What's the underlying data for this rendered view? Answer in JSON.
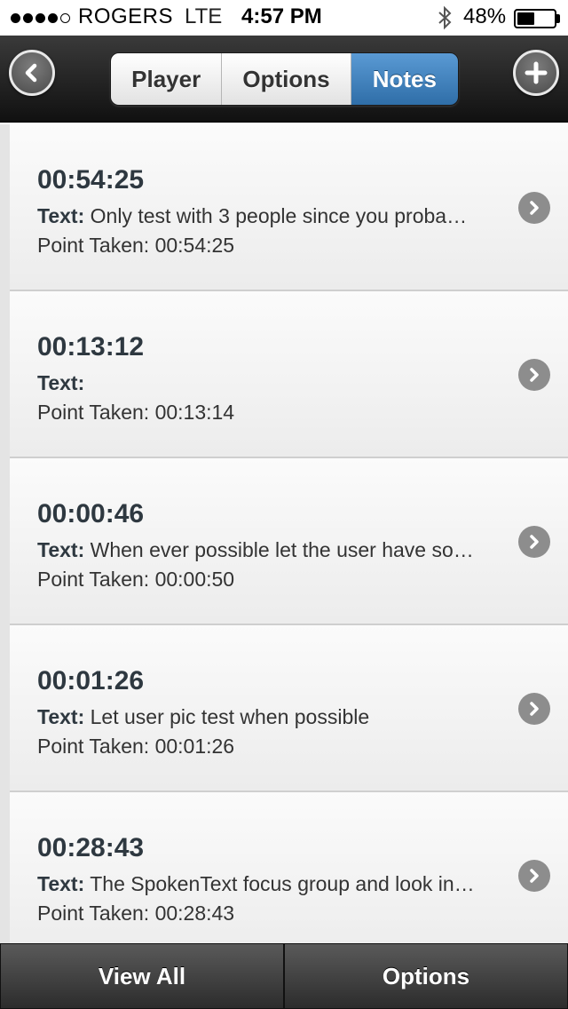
{
  "status_bar": {
    "carrier": "ROGERS",
    "network": "LTE",
    "time": "4:57 PM",
    "battery_percent": "48%",
    "battery_level": 0.48,
    "signal_bars": 4,
    "signal_total": 5
  },
  "header": {
    "back_icon": "back-arrow-icon",
    "add_icon": "plus-icon",
    "tabs": [
      {
        "label": "Player",
        "active": false
      },
      {
        "label": "Options",
        "active": false
      },
      {
        "label": "Notes",
        "active": true
      }
    ],
    "active_color": "#3a7fbf"
  },
  "notes": [
    {
      "time": "00:54:25",
      "text_label": "Text:",
      "text": " Only test with 3 people since you proba…",
      "point_label": "Point Taken:",
      "point": "00:54:25"
    },
    {
      "time": "00:13:12",
      "text_label": "Text:",
      "text": "",
      "point_label": "Point Taken:",
      "point": "00:13:14"
    },
    {
      "time": "00:00:46",
      "text_label": "Text:",
      "text": " When ever possible let the user have so…",
      "point_label": "Point Taken:",
      "point": "00:00:50"
    },
    {
      "time": "00:01:26",
      "text_label": "Text:",
      "text": " Let user pic test when possible",
      "point_label": "Point Taken:",
      "point": "00:01:26"
    },
    {
      "time": "00:28:43",
      "text_label": "Text:",
      "text": " The SpokenText focus group and look in…",
      "point_label": "Point Taken:",
      "point": "00:28:43"
    }
  ],
  "footer": {
    "view_all": "View All",
    "options": "Options"
  }
}
